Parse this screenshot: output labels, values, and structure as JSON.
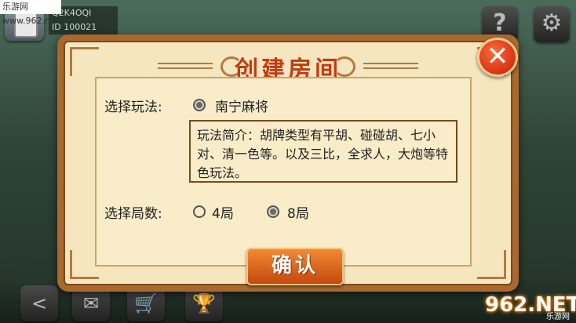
{
  "watermark": "乐游网 www.962.net",
  "user": {
    "name": "Q2K4OQI",
    "id": "ID 100021"
  },
  "top_buttons": {
    "help_glyph": "?",
    "settings_glyph": "⚙"
  },
  "dialog": {
    "title": "创建房间",
    "close_glyph": "✕",
    "play_mode_label": "选择玩法:",
    "play_mode_option": "南宁麻将",
    "description": "玩法简介：胡牌类型有平胡、碰碰胡、七小对、清一色等。以及三比，全求人，大炮等特色玩法。",
    "rounds_label": "选择局数:",
    "round_options": [
      {
        "label": "4局",
        "selected": false
      },
      {
        "label": "8局",
        "selected": true
      }
    ],
    "confirm_label": "确认"
  },
  "bottom_buttons": [
    {
      "icon": "share-icon",
      "glyph": "<"
    },
    {
      "icon": "mail-icon",
      "glyph": "✉"
    },
    {
      "icon": "cart-icon",
      "glyph": "🛒"
    },
    {
      "icon": "trophy-icon",
      "glyph": "🏆"
    }
  ],
  "brand": {
    "main": "962.NET",
    "sub": "乐游网"
  }
}
